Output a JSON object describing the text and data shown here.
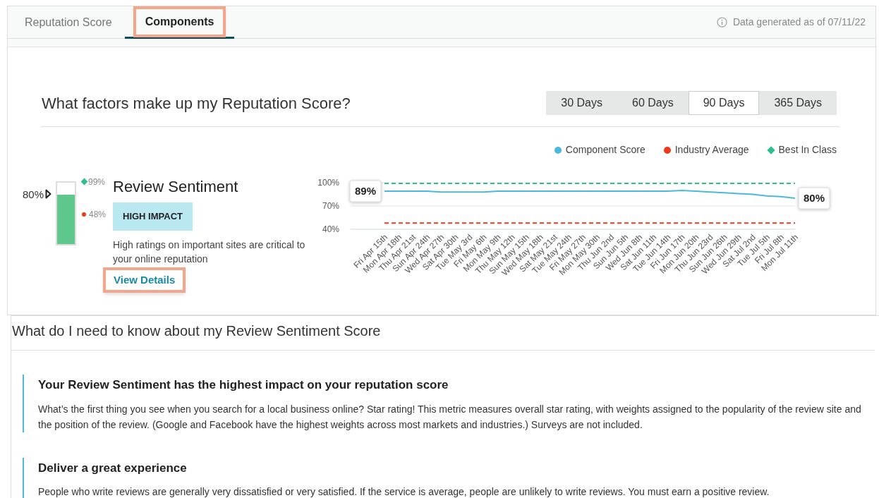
{
  "tabs": [
    {
      "label": "Reputation Score",
      "selected": false,
      "highlighted": false
    },
    {
      "label": "Components",
      "selected": true,
      "highlighted": true
    }
  ],
  "data_note": "Data generated as of 07/11/22",
  "heading": "What factors make up my Reputation Score?",
  "periods": [
    {
      "label": "30 Days",
      "selected": false
    },
    {
      "label": "60 Days",
      "selected": false
    },
    {
      "label": "90 Days",
      "selected": true
    },
    {
      "label": "365 Days",
      "selected": false
    }
  ],
  "legend": [
    {
      "color": "#4bb8dc",
      "kind": "dot"
    },
    {
      "color": "#ee3a1c",
      "kind": "dot"
    },
    {
      "color": "#2ebf8c",
      "kind": "diamond"
    }
  ],
  "component": {
    "score_label": "80%",
    "level": 0.8,
    "best_label": "99%",
    "avg_label": "48%",
    "title": "Review Sentiment",
    "badge": "HIGH IMPACT",
    "description": "High ratings on important sites are critical to your online reputation",
    "link": {
      "label": "View Details",
      "highlighted": true
    }
  },
  "chart_data": {
    "type": "line",
    "categories": [
      "Fri Apr 15th",
      "Mon Apr 18th",
      "Thu Apr 21st",
      "Sun Apr 24th",
      "Wed Apr 27th",
      "Sat Apr 30th",
      "Tue May 3rd",
      "Fri May 6th",
      "Mon May 9th",
      "Thu May 12th",
      "Sun May 15th",
      "Wed May 18th",
      "Sat May 21st",
      "Tue May 24th",
      "Fri May 27th",
      "Mon May 30th",
      "Thu Jun 2nd",
      "Sun Jun 5th",
      "Wed Jun 8th",
      "Sat Jun 11th",
      "Tue Jun 14th",
      "Fri Jun 17th",
      "Mon Jun 20th",
      "Thu Jun 23rd",
      "Sun Jun 26th",
      "Wed Jun 29th",
      "Sat Jul 2nd",
      "Tue Jul 5th",
      "Fri Jul 8th",
      "Mon Jul 11th"
    ],
    "series": [
      {
        "name": "Component Score",
        "color": "#4bb8dc",
        "line_style": "solid",
        "values": [
          89,
          89,
          89,
          89,
          88,
          88,
          88,
          88,
          89,
          89,
          89,
          89,
          89,
          89,
          89,
          89,
          89,
          89,
          89,
          89,
          89,
          90,
          89,
          88,
          87,
          86,
          85,
          83,
          82,
          80
        ]
      },
      {
        "name": "Industry Average",
        "color": "#ee3a1c",
        "line_style": "dashed",
        "values": [
          48,
          48,
          48,
          48,
          48,
          48,
          48,
          48,
          48,
          48,
          48,
          48,
          48,
          48,
          48,
          48,
          48,
          48,
          48,
          48,
          48,
          48,
          48,
          48,
          48,
          48,
          48,
          48,
          48,
          48
        ]
      },
      {
        "name": "Best In Class",
        "color": "#2ebf8c",
        "line_style": "dashed",
        "values": [
          99,
          99,
          99,
          99,
          99,
          99,
          99,
          99,
          99,
          99,
          99,
          99,
          99,
          99,
          99,
          99,
          99,
          99,
          99,
          99,
          99,
          99,
          99,
          99,
          99,
          99,
          99,
          99,
          99,
          99
        ]
      }
    ],
    "ylim": [
      40,
      100
    ],
    "yticks": [
      {
        "value": 40,
        "label": "40%"
      },
      {
        "value": 70,
        "label": "70%"
      },
      {
        "value": 100,
        "label": "100%"
      }
    ],
    "annotations": [
      {
        "x": "Fri Apr 15th",
        "text": "89%"
      },
      {
        "x": "Mon Jul 11th",
        "text": "80%"
      }
    ]
  },
  "details": {
    "title": "What do I need to know about my Review Sentiment Score",
    "sections": [
      {
        "title": "Your Review Sentiment has the highest impact on your reputation score",
        "text": "What’s the first thing you see when you search for a local business online? Star rating! This metric measures overall star rating, with weights assigned to the popularity of the review site and the position of the review. (Google and Facebook have the highest weights across most markets and industries.) Surveys are not included."
      },
      {
        "title": "Deliver a great experience",
        "text": "People who write reviews are generally very dissatisfied or very satisfied. If the service is average, people are unlikely to write reviews. You must earn a positive review."
      }
    ]
  }
}
